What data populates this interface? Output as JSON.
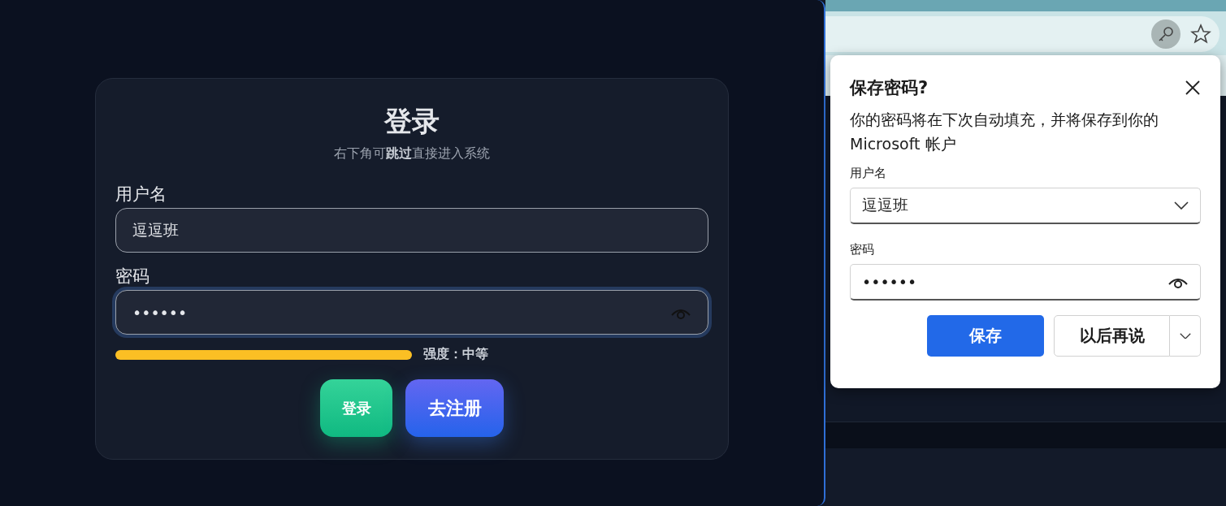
{
  "login": {
    "title": "登录",
    "subtitle": "右下角可**跳过**直接进入系统",
    "username": {
      "label": "用户名",
      "value": "逗逗班"
    },
    "password": {
      "label": "密码",
      "value": "••••••",
      "focused": true
    },
    "strength": {
      "label": "强度：中等"
    },
    "buttons": [
      {
        "label": "登录",
        "kind": "primary"
      },
      {
        "label": "去注册",
        "kind": "secondary"
      }
    ]
  },
  "save_password_popup": {
    "title": "保存密码?",
    "message": "你的密码将在下次自动填充，并将保存到你的 Microsoft 帐户",
    "username": {
      "label": "用户名",
      "value": "逗逗班"
    },
    "password": {
      "label": "密码",
      "value": "••••••"
    },
    "buttons": [
      {
        "label": "保存",
        "kind": "primary"
      },
      {
        "label": "以后再说",
        "kind": "secondary"
      }
    ]
  }
}
